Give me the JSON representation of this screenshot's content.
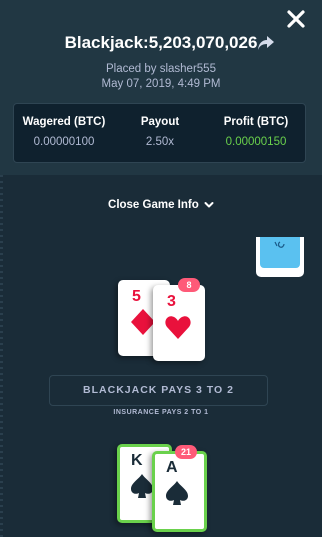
{
  "bet": {
    "title": "Blackjack:5,203,070,026",
    "placed_by": "Placed by slasher555",
    "placed_time": "May 07, 2019, 4:49 PM"
  },
  "stats": {
    "wagered_label": "Wagered (BTC)",
    "wagered_value": "0.00000100",
    "payout_label": "Payout",
    "payout_value": "2.50x",
    "profit_label": "Profit (BTC)",
    "profit_value": "0.00000150"
  },
  "toggle_label": "Close Game Info",
  "dealer": {
    "score": "8",
    "cards": [
      {
        "rank": "5",
        "suit": "diamond"
      },
      {
        "rank": "3",
        "suit": "heart"
      }
    ]
  },
  "player": {
    "score": "21",
    "cards": [
      {
        "rank": "K",
        "suit": "spade"
      },
      {
        "rank": "A",
        "suit": "spade"
      }
    ]
  },
  "rules": {
    "blackjack_pays": "BLACKJACK PAYS 3 TO 2",
    "insurance_pays": "INSURANCE PAYS 2 TO 1"
  },
  "colors": {
    "background": "#1a2c38",
    "panel": "#213743",
    "profit_green": "#6ad14c",
    "badge_red": "#fe5a78",
    "deck_blue": "#5ac1f0"
  },
  "icons": {
    "close": "close-icon",
    "share": "share-arrow-icon",
    "chevron": "chevron-down-icon",
    "deck": "card-deck-icon"
  }
}
